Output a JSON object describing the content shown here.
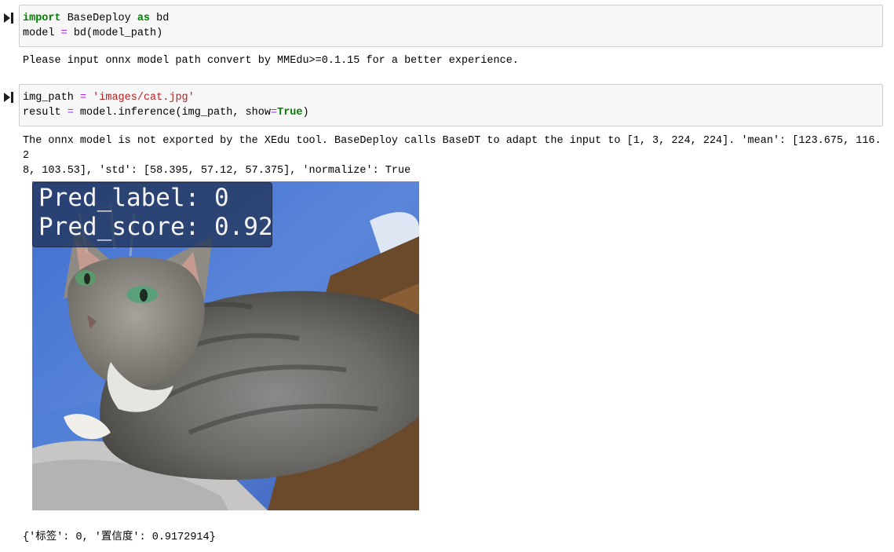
{
  "cell1": {
    "code_line1": {
      "kw1": "import",
      "name": " BaseDeploy ",
      "kw2": "as",
      "alias": " bd"
    },
    "code_line2": {
      "lhs": "model ",
      "op": "=",
      "rhs": " bd(model_path)"
    },
    "output": "Please input onnx model path convert by MMEdu>=0.1.15 for a better experience."
  },
  "cell2": {
    "code_line1": {
      "lhs": "img_path ",
      "op": "=",
      "sp": " ",
      "str": "'images/cat.jpg'"
    },
    "code_line2": {
      "lhs": "result ",
      "op": "=",
      "call": " model.inference(img_path, show",
      "op2": "=",
      "kw": "True",
      "close": ")"
    },
    "output_line1": "The onnx model is not exported by the XEdu tool. BaseDeploy calls BaseDT to adapt the input to [1, 3, 224, 224]. 'mean': [123.675, 116.2",
    "output_line2": "8, 103.53], 'std': [58.395, 57.12, 57.375], 'normalize': True",
    "image_overlay": {
      "line1": "Pred_label: 0",
      "line2": "Pred_score: 0.92"
    },
    "result": "{'标签': 0, '置信度': 0.9172914}"
  },
  "colors": {
    "keyword": "#008000",
    "operator": "#aa22ff",
    "string": "#ba2121",
    "cell_bg": "#f7f7f7",
    "cell_border": "#cfcfcf"
  }
}
